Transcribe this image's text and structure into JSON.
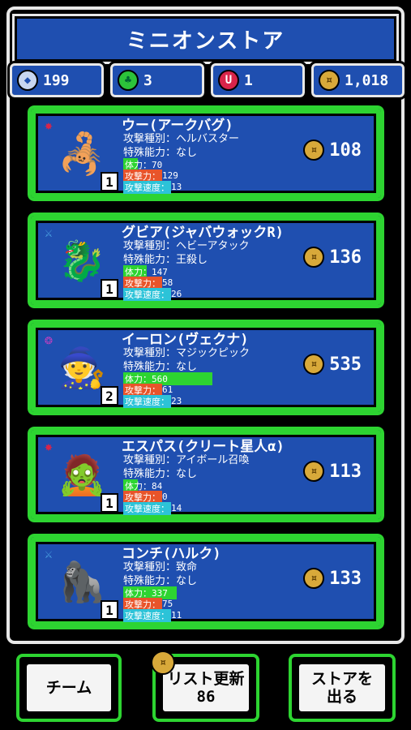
{
  "store": {
    "title": "ミニオンストア"
  },
  "currencies": [
    {
      "icon": "shield-icon",
      "value": "199",
      "color": "#c8d6f0"
    },
    {
      "icon": "clover-icon",
      "value": "3",
      "color": "#2cc33a"
    },
    {
      "icon": "u-gem-icon",
      "value": "1",
      "color": "#d8244a"
    },
    {
      "icon": "coin-icon",
      "value": "1,018",
      "color": "#d8a93a"
    }
  ],
  "stat_labels": {
    "attack_type": "攻撃種別：",
    "special": "特殊能力：",
    "hp": "体力：",
    "atk": "攻撃力：",
    "speed": "攻撃速度："
  },
  "minions": [
    {
      "name": "ウー(アークバグ)",
      "attack_type": "ヘルバスター",
      "special": "なし",
      "hp": "70",
      "atk": "129",
      "speed": "13",
      "level": "1",
      "price": "108",
      "type_icon": "star-icon",
      "type_color": "#d8244a",
      "sprite": "🦂",
      "hp_bar": 0.12
    },
    {
      "name": "グビア(ジャバウォックR)",
      "attack_type": "ヘビーアタック",
      "special": "王殺し",
      "hp": "147",
      "atk": "58",
      "speed": "26",
      "level": "1",
      "price": "136",
      "type_icon": "sword-icon",
      "type_color": "#4aa0e0",
      "sprite": "🐉",
      "hp_bar": 0.26
    },
    {
      "name": "イーロン(ヴェクナ)",
      "attack_type": "マジックピック",
      "special": "なし",
      "hp": "560",
      "atk": "61",
      "speed": "23",
      "level": "2",
      "price": "535",
      "type_icon": "swirl-icon",
      "type_color": "#c040c0",
      "sprite": "🧙",
      "hp_bar": 1.0
    },
    {
      "name": "エスパス(クリート星人α)",
      "attack_type": "アイボール召喚",
      "special": "なし",
      "hp": "84",
      "atk": "0",
      "speed": "14",
      "level": "1",
      "price": "113",
      "type_icon": "star-icon",
      "type_color": "#d8244a",
      "sprite": "🧟",
      "hp_bar": 0.15
    },
    {
      "name": "コンチ(ハルク)",
      "attack_type": "致命",
      "special": "なし",
      "hp": "337",
      "atk": "75",
      "speed": "11",
      "level": "1",
      "price": "133",
      "type_icon": "sword-icon",
      "type_color": "#4aa0e0",
      "sprite": "🦍",
      "hp_bar": 0.6
    }
  ],
  "buttons": {
    "team": "チーム",
    "refresh": "リスト更新\n86",
    "exit": "ストアを\n出る"
  }
}
